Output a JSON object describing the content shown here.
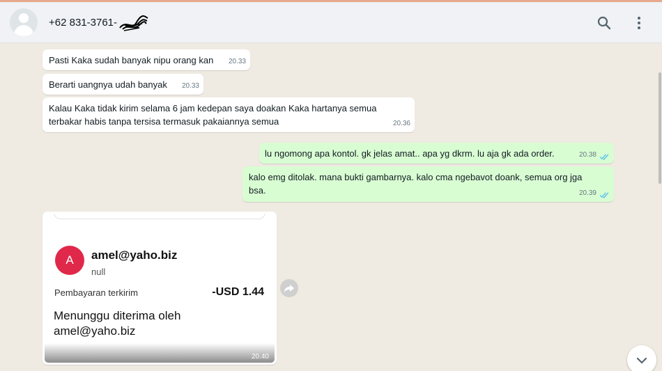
{
  "header": {
    "contact_name": "+62 831-3761-",
    "icons": [
      "default-avatar-icon",
      "search-icon",
      "menu-icon"
    ]
  },
  "messages": [
    {
      "direction": "incoming",
      "text": "Pasti Kaka sudah banyak nipu orang kan",
      "time": "20.33"
    },
    {
      "direction": "incoming",
      "text": "Berarti uangnya udah banyak",
      "time": "20.33"
    },
    {
      "direction": "incoming",
      "text_lines": [
        "Kalau Kaka tidak kirim selama 6 jam kedepan saya doakan Kaka hartanya semua",
        "terbakar habis tanpa tersisa termasuk pakaiannya semua"
      ],
      "time": "20.36"
    },
    {
      "direction": "outgoing",
      "text": "lu ngomong apa kontol. gk jelas amat.. apa yg dkrm. lu aja gk ada order.",
      "time": "20.38",
      "status": "read"
    },
    {
      "direction": "outgoing",
      "text_lines": [
        "kalo emg ditolak. mana bukti gambarnya. kalo cma ngebavot doank, semua org jga",
        "bsa."
      ],
      "time": "20.39",
      "status": "read"
    }
  ],
  "image_message": {
    "avatar_letter": "A",
    "email": "amel@yaho.biz",
    "subtitle": "null",
    "payment_label": "Pembayaran terkirim",
    "amount": "-USD 1.44",
    "waiting_lines": [
      "Menunggu diterima oleh",
      "amel@yaho.biz"
    ],
    "time": "20.40"
  },
  "colors": {
    "incoming_bubble": "#ffffff",
    "outgoing_bubble": "#d9fdd3",
    "chat_background": "#efeae2",
    "read_ticks": "#53bdeb",
    "payment_avatar": "#e0284a"
  }
}
